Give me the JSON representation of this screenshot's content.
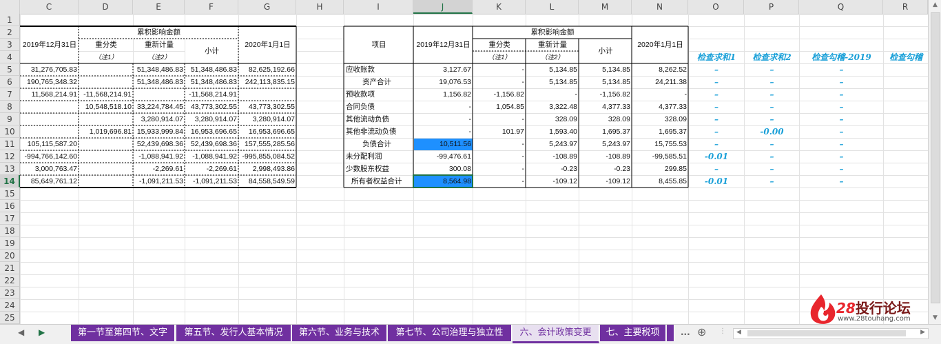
{
  "columns": [
    "C",
    "D",
    "E",
    "F",
    "G",
    "H",
    "I",
    "J",
    "K",
    "L",
    "M",
    "N",
    "O",
    "P",
    "Q",
    "R"
  ],
  "rows": [
    "1",
    "2",
    "3",
    "4",
    "5",
    "6",
    "7",
    "8",
    "9",
    "10",
    "11",
    "12",
    "13",
    "14",
    "15",
    "16",
    "17",
    "18",
    "19",
    "20",
    "21",
    "22",
    "23",
    "24",
    "25"
  ],
  "left_table": {
    "header_cum": "累积影响金额",
    "h_date1": "2019年12月31日",
    "h_reclass": "重分类",
    "h_remeasure": "重新计量",
    "h_subtotal": "小计",
    "h_date2": "2020年1月1日",
    "h_note1": "（注1）",
    "h_note2": "（注2）",
    "rows": [
      [
        "31,276,705.83",
        "",
        "51,348,486.83",
        "51,348,486.83",
        "82,625,192.66"
      ],
      [
        "190,765,348.32",
        "",
        "51,348,486.83",
        "51,348,486.83",
        "242,113,835.15"
      ],
      [
        "11,568,214.91",
        "-11,568,214.91",
        "",
        "-11,568,214.91",
        ""
      ],
      [
        "",
        "10,548,518.10",
        "33,224,784.45",
        "43,773,302.55",
        "43,773,302.55"
      ],
      [
        "",
        "",
        "3,280,914.07",
        "3,280,914.07",
        "3,280,914.07"
      ],
      [
        "",
        "1,019,696.81",
        "15,933,999.84",
        "16,953,696.65",
        "16,953,696.65"
      ],
      [
        "105,115,587.20",
        "",
        "52,439,698.36",
        "52,439,698.36",
        "157,555,285.56"
      ],
      [
        "-994,766,142.60",
        "",
        "-1,088,941.92",
        "-1,088,941.92",
        "-995,855,084.52"
      ],
      [
        "3,000,763.47",
        "",
        "-2,269.61",
        "-2,269.61",
        "2,998,493.86"
      ],
      [
        "85,649,761.12",
        "",
        "-1,091,211.53",
        "-1,091,211.53",
        "84,558,549.59"
      ]
    ]
  },
  "right_table": {
    "h_item": "项目",
    "h_date1": "2019年12月31日",
    "header_cum": "累积影响金额",
    "h_reclass": "重分类",
    "h_remeasure": "重新计量",
    "h_subtotal": "小计",
    "h_date2": "2020年1月1日",
    "h_note1": "（注1）",
    "h_note2": "（注2）",
    "check_headers": [
      "检查求和1",
      "检查求和2",
      "检查勾稽-2019",
      "检查勾稽"
    ],
    "rows": [
      {
        "item": "应收账款",
        "j": "3,127.67",
        "k": "-",
        "l": "5,134.85",
        "m": "5,134.85",
        "n": "8,262.52",
        "o": "–",
        "p": "–",
        "q": "–"
      },
      {
        "item": "资产合计",
        "j": "19,076.53",
        "k": "-",
        "l": "5,134.85",
        "m": "5,134.85",
        "n": "24,211.38",
        "o": "–",
        "p": "–",
        "q": "–"
      },
      {
        "item": "预收款项",
        "j": "1,156.82",
        "k": "-1,156.82",
        "l": "-",
        "m": "-1,156.82",
        "n": "-",
        "o": "–",
        "p": "–",
        "q": "–"
      },
      {
        "item": "合同负债",
        "j": "-",
        "k": "1,054.85",
        "l": "3,322.48",
        "m": "4,377.33",
        "n": "4,377.33",
        "o": "–",
        "p": "–",
        "q": "–"
      },
      {
        "item": "其他流动负债",
        "j": "-",
        "k": "-",
        "l": "328.09",
        "m": "328.09",
        "n": "328.09",
        "o": "–",
        "p": "–",
        "q": "–"
      },
      {
        "item": "其他非流动负债",
        "j": "-",
        "k": "101.97",
        "l": "1,593.40",
        "m": "1,695.37",
        "n": "1,695.37",
        "o": "–",
        "p": "-0.00",
        "q": "–"
      },
      {
        "item": "负债合计",
        "j": "10,511.56",
        "k": "-",
        "l": "5,243.97",
        "m": "5,243.97",
        "n": "15,755.53",
        "o": "–",
        "p": "–",
        "q": "–"
      },
      {
        "item": "未分配利润",
        "j": "-99,476.61",
        "k": "-",
        "l": "-108.89",
        "m": "-108.89",
        "n": "-99,585.51",
        "o": "-0.01",
        "p": "–",
        "q": "–"
      },
      {
        "item": "少数股东权益",
        "j": "300.08",
        "k": "-",
        "l": "-0.23",
        "m": "-0.23",
        "n": "299.85",
        "o": "–",
        "p": "–",
        "q": "–"
      },
      {
        "item": "所有者权益合计",
        "j": "8,564.98",
        "k": "-",
        "l": "-109.12",
        "m": "-109.12",
        "n": "8,455.85",
        "o": "-0.01",
        "p": "–",
        "q": "–"
      }
    ]
  },
  "tabs": [
    "第一节至第四节、文字",
    "第五节、发行人基本情况",
    "第六节、业务与技术",
    "第七节、公司治理与独立性",
    "六、会计政策变更",
    "七、主要税项"
  ],
  "active_tab": "六、会计政策变更",
  "more": "...",
  "logo": {
    "brand_num": "28",
    "brand_text": "投行论坛",
    "url": "www.28touhang.com"
  },
  "colors": {
    "tab": "#7030a0",
    "check": "#1aa0d8",
    "selection": "#1e90ff",
    "accent": "#217346"
  }
}
